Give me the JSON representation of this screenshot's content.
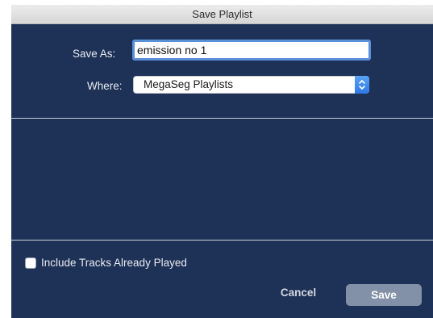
{
  "dialog": {
    "title": "Save Playlist"
  },
  "form": {
    "save_as_label": "Save As:",
    "save_as_value": "emission no 1",
    "where_label": "Where:",
    "where_value": "MegaSeg Playlists"
  },
  "options": {
    "include_played_label": "Include Tracks Already Played",
    "include_played_checked": false
  },
  "buttons": {
    "cancel_label": "Cancel",
    "save_label": "Save"
  },
  "colors": {
    "background": "#1e3257",
    "focus_ring": "#5b8fd8",
    "select_arrow": "#2c79e6",
    "save_button": "#8291a7"
  },
  "icons": {
    "select_arrow": "chevron-up-down-icon"
  }
}
